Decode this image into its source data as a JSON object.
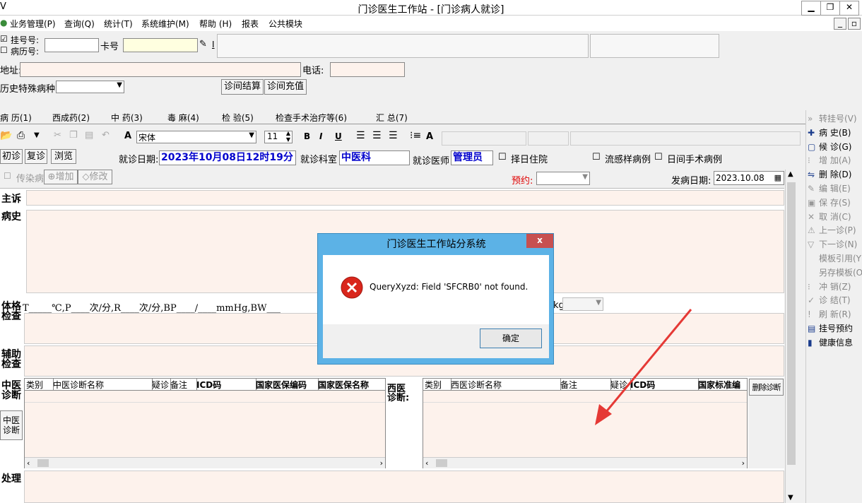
{
  "window": {
    "title": "门诊医生工作站 - [门诊病人就诊]",
    "logo_glyph": "V"
  },
  "menu": [
    "业务管理(P)",
    "查询(Q)",
    "统计(T)",
    "系统维护(M)",
    "帮助 (H)",
    "报表",
    "公共模块"
  ],
  "patient": {
    "reg_no_label": "挂号号:",
    "record_no_label": "病历号:",
    "card_label": "卡号",
    "address_label": "地址:",
    "phone_label": "电话:",
    "special_label": "历史特殊病种",
    "settle_btn": "诊间结算",
    "recharge_btn": "诊间充值",
    "i_glyph": "I"
  },
  "tabs": [
    "病 历(1)",
    "西成药(2)",
    "中 药(3)",
    "毒 麻(4)",
    "检 验(5)",
    "检查手术治疗等(6)",
    "汇 总(7)"
  ],
  "toolbar": {
    "font_name": "宋体",
    "font_size": "11",
    "bold": "B",
    "italic": "I",
    "underline": "U",
    "aa": "A"
  },
  "visit": {
    "first": "初诊",
    "return": "复诊",
    "browse": "浏览",
    "date_label": "就诊日期:",
    "date_value": "2023年10月08日12时19分",
    "dept_label": "就诊科室",
    "dept_value": "中医科",
    "doctor_label": "就诊医师",
    "doctor_value": "管理员",
    "hosp_label": "择日住院",
    "flu_label": "流感样病例",
    "day_surgery_label": "日间手术病例"
  },
  "row2": {
    "infect": "传染病",
    "add": "增加",
    "modify": "修改",
    "appt_label": "预约:",
    "onset_label": "发病日期:",
    "onset_value": "2023.10.08"
  },
  "sections": {
    "chief": "主诉",
    "history": "病史",
    "exam1": "体格",
    "exam2": "检查",
    "aux1": "辅助",
    "aux2": "检查",
    "tcm1": "中医",
    "tcm2": "诊断",
    "western1": "西医",
    "western2": "诊断:",
    "treat": "处理",
    "tcm_btn1": "中医",
    "tcm_btn2": "诊断",
    "delete_diag": "删除诊断"
  },
  "vitals_line": "T_____℃,P____次/分,R____次/分,BP____/____mmHg,BW___",
  "vitals_tail": "kg",
  "tcm_headers": [
    "类别",
    "中医诊断名称",
    "疑诊",
    "备注",
    "ICD码",
    "国家医保编码",
    "国家医保名称"
  ],
  "western_headers": [
    "类别",
    "西医诊断名称",
    "备注",
    "疑诊",
    "ICD码",
    "国家标准编"
  ],
  "right_panel": [
    {
      "label": "转挂号(V)",
      "active": false
    },
    {
      "label": "病 史(B)",
      "active": true
    },
    {
      "label": "候 诊(G)",
      "active": true
    },
    {
      "label": "增 加(A)",
      "active": false
    },
    {
      "label": "删 除(D)",
      "active": true
    },
    {
      "label": "编 辑(E)",
      "active": false
    },
    {
      "label": "保 存(S)",
      "active": false
    },
    {
      "label": "取 消(C)",
      "active": false
    },
    {
      "label": "上一诊(P)",
      "active": false
    },
    {
      "label": "下一诊(N)",
      "active": false
    },
    {
      "label": "模板引用(Y)",
      "active": false
    },
    {
      "label": "另存模板(O)",
      "active": false
    },
    {
      "label": "冲 销(Z)",
      "active": false
    },
    {
      "label": "诊 结(T)",
      "active": false
    },
    {
      "label": "刷 新(R)",
      "active": false
    },
    {
      "label": "挂号预约",
      "active": true
    },
    {
      "label": "健康信息",
      "active": true
    }
  ],
  "dialog": {
    "title": "门诊医生工作站分系统",
    "message": "QueryXyzd: Field 'SFCRB0' not found.",
    "ok": "确定",
    "close": "x",
    "colors": {
      "title_bg": "#5cb2e6",
      "close_bg": "#c75050",
      "error": "#d9261c"
    }
  },
  "colors": {
    "arrow": "#e53935",
    "blue_text": "#0000cc",
    "red_text": "#e00000",
    "peach": "#fdf2ec"
  }
}
